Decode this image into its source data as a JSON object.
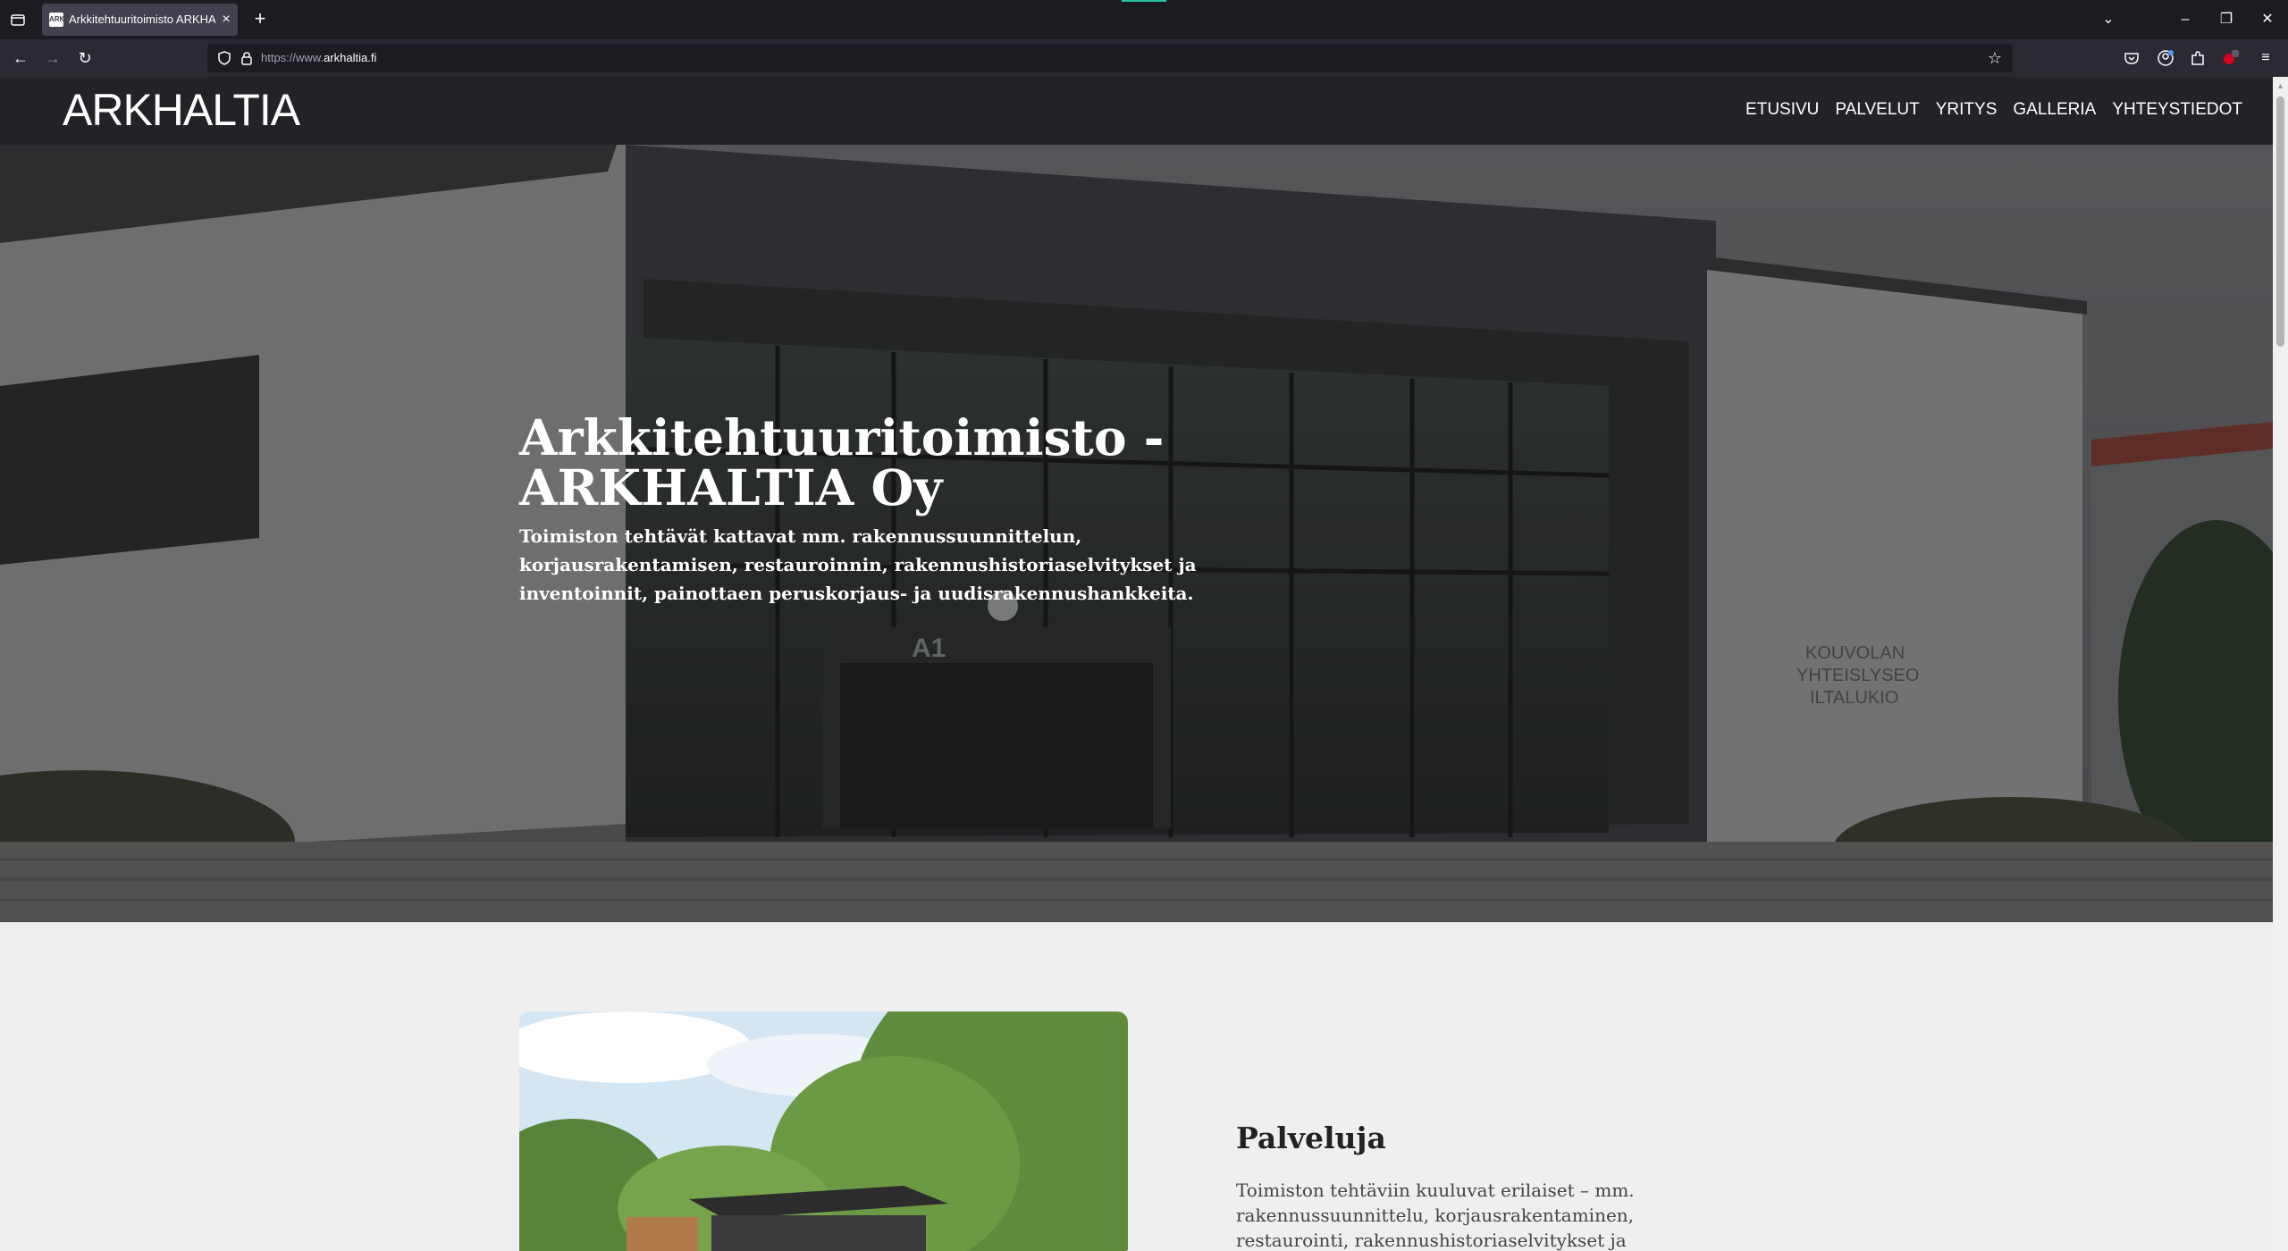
{
  "browser": {
    "tab_title": "Arkkitehtuuritoimisto ARKHALTIA",
    "tab_favicon_text": "ARK",
    "url_prefix": "https://www.",
    "url_domain": "arkhaltia.fi"
  },
  "site": {
    "logo": "ARKHALTIA",
    "nav": [
      "ETUSIVU",
      "PALVELUT",
      "YRITYS",
      "GALLERIA",
      "YHTEYSTIEDOT"
    ]
  },
  "hero": {
    "title_line1": "Arkkitehtuuritoimisto -",
    "title_line2": "ARKHALTIA Oy",
    "text": "Toimiston tehtävät kattavat mm. rakennussuunnittelun, korjausrakentamisen, restauroinnin, rakennushistoriaselvitykset ja inventoinnit, painottaen peruskorjaus- ja uudisrakennushankkeita.",
    "photo_sign": "A1",
    "photo_building_sign": [
      "KOUVOLAN",
      "YHTEISLYSEO",
      "ILTALUKIO"
    ]
  },
  "section": {
    "heading": "Palveluja",
    "text": "Toimiston tehtäviin kuuluvat erilaiset – mm. rakennussuunnittelu, korjausrakentaminen, restaurointi, rakennushistoriaselvitykset ja inventointitehtävät –"
  },
  "colors": {
    "header_bg": "#222326",
    "page_bg": "#efefef",
    "chrome_bg": "#1c1b22",
    "toolbar_bg": "#2b2a33"
  }
}
